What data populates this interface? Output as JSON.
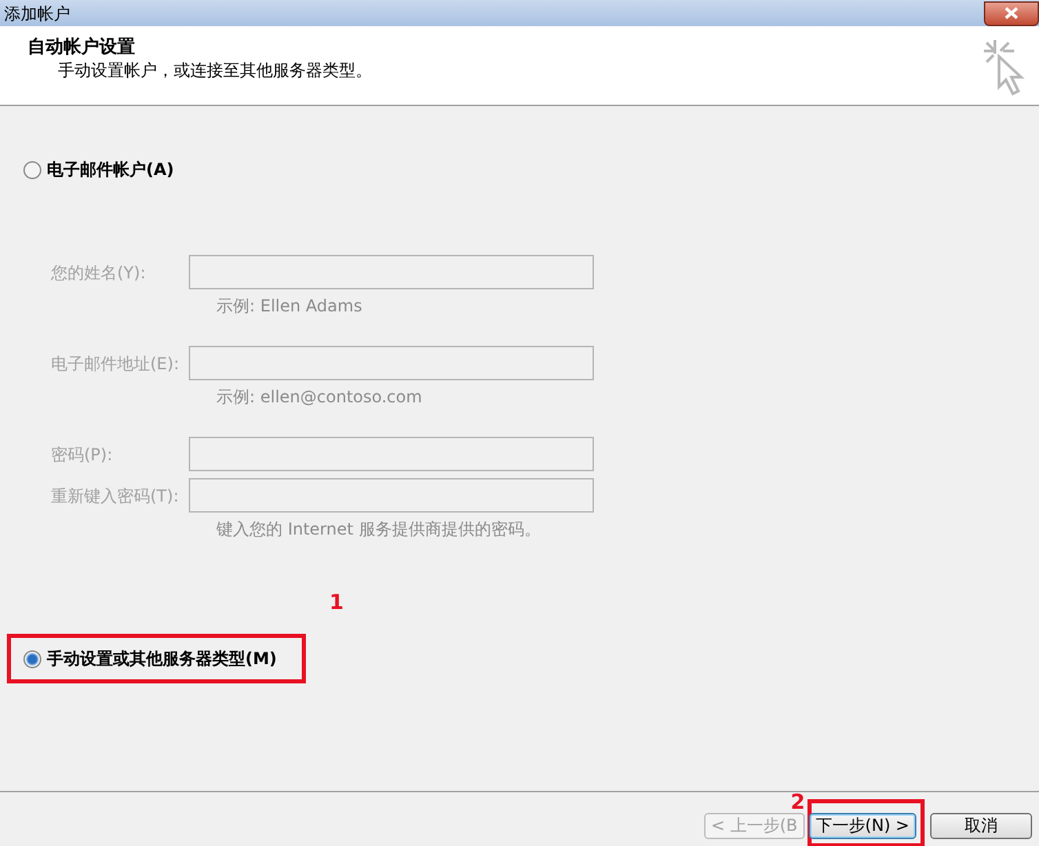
{
  "window": {
    "title": "添加帐户"
  },
  "header": {
    "title": "自动帐户设置",
    "subtitle": "手动设置帐户，或连接至其他服务器类型。"
  },
  "options": [
    {
      "label": "电子邮件帐户(A)",
      "selected": false,
      "highlighted": false
    },
    {
      "label": "手动设置或其他服务器类型(M)",
      "selected": true,
      "highlighted": true,
      "callout": "1"
    }
  ],
  "fields": [
    {
      "label": "您的姓名(Y):",
      "disabled": true,
      "hint": "示例: Ellen Adams"
    },
    {
      "label": "电子邮件地址(E):",
      "disabled": true,
      "hint": "示例: ellen@contoso.com"
    },
    {
      "label": "密码(P):",
      "disabled": true
    },
    {
      "label": "重新键入密码(T):",
      "disabled": true,
      "hint": "键入您的 Internet 服务提供商提供的密码。"
    }
  ],
  "buttons": [
    {
      "label": "< 上一步(B",
      "disabled": true,
      "default": false,
      "highlighted": false
    },
    {
      "label": "下一步(N) >",
      "disabled": false,
      "default": true,
      "highlighted": true,
      "callout": "2"
    },
    {
      "label": "取消",
      "disabled": false,
      "default": false,
      "highlighted": false
    }
  ]
}
